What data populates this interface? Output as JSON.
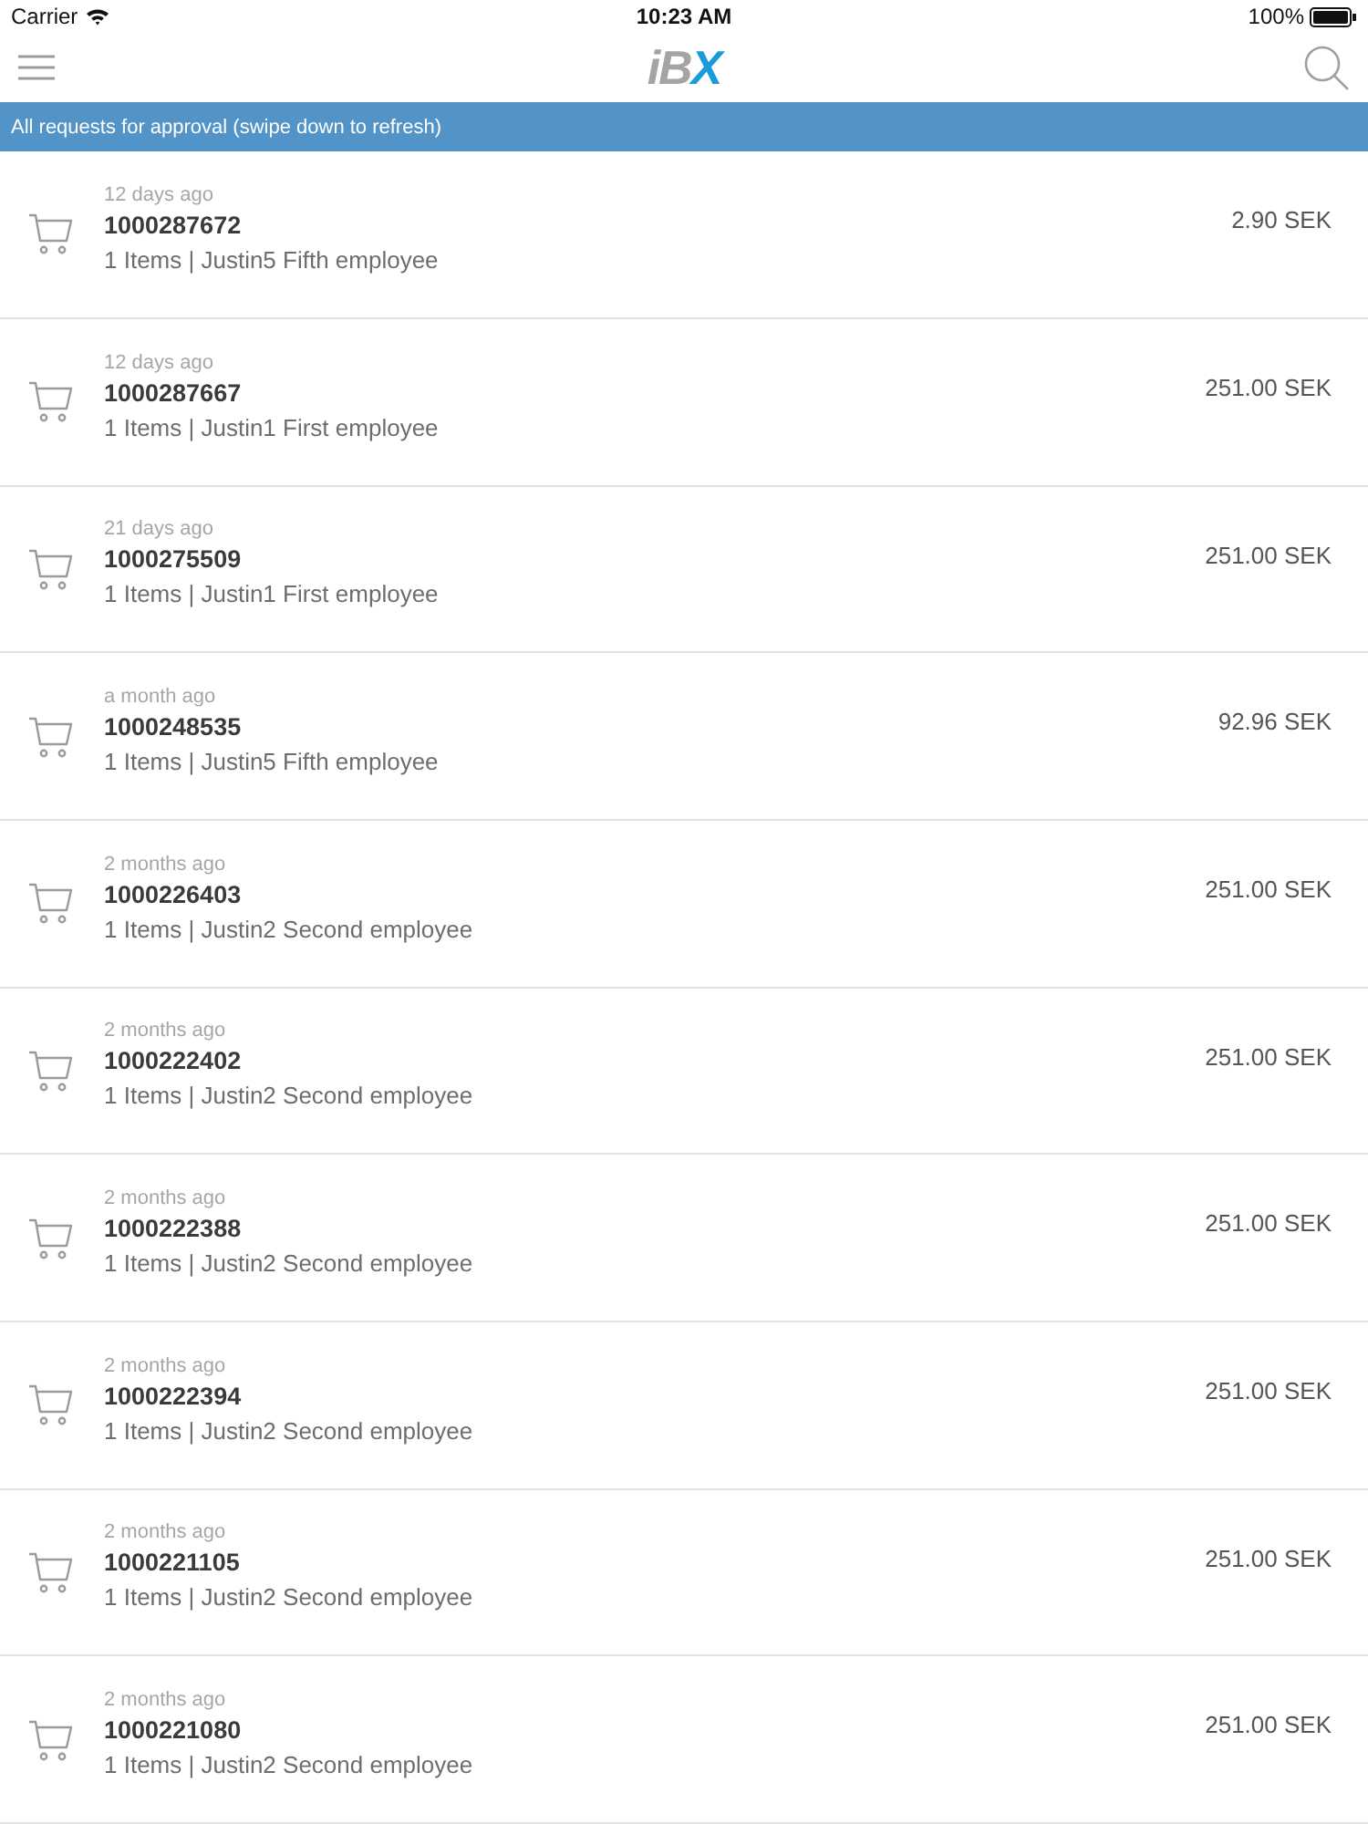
{
  "status_bar": {
    "carrier": "Carrier",
    "time": "10:23 AM",
    "battery": "100%"
  },
  "nav_bar": {
    "logo": {
      "lead": "iB",
      "accent": "X"
    }
  },
  "banner": {
    "text": "All requests for approval (swipe down to refresh)"
  },
  "requests": [
    {
      "age": "12 days ago",
      "number": "1000287672",
      "summary": "1 Items | Justin5 Fifth employee",
      "amount": "2.90 SEK"
    },
    {
      "age": "12 days ago",
      "number": "1000287667",
      "summary": "1 Items | Justin1 First employee",
      "amount": "251.00 SEK"
    },
    {
      "age": "21 days ago",
      "number": "1000275509",
      "summary": "1 Items | Justin1 First employee",
      "amount": "251.00 SEK"
    },
    {
      "age": "a month ago",
      "number": "1000248535",
      "summary": "1 Items | Justin5 Fifth employee",
      "amount": "92.96 SEK"
    },
    {
      "age": "2 months ago",
      "number": "1000226403",
      "summary": "1 Items | Justin2 Second employee",
      "amount": "251.00 SEK"
    },
    {
      "age": "2 months ago",
      "number": "1000222402",
      "summary": "1 Items | Justin2 Second employee",
      "amount": "251.00 SEK"
    },
    {
      "age": "2 months ago",
      "number": "1000222388",
      "summary": "1 Items | Justin2 Second employee",
      "amount": "251.00 SEK"
    },
    {
      "age": "2 months ago",
      "number": "1000222394",
      "summary": "1 Items | Justin2 Second employee",
      "amount": "251.00 SEK"
    },
    {
      "age": "2 months ago",
      "number": "1000221105",
      "summary": "1 Items | Justin2 Second employee",
      "amount": "251.00 SEK"
    },
    {
      "age": "2 months ago",
      "number": "1000221080",
      "summary": "1 Items | Justin2 Second employee",
      "amount": "251.00 SEK"
    }
  ]
}
